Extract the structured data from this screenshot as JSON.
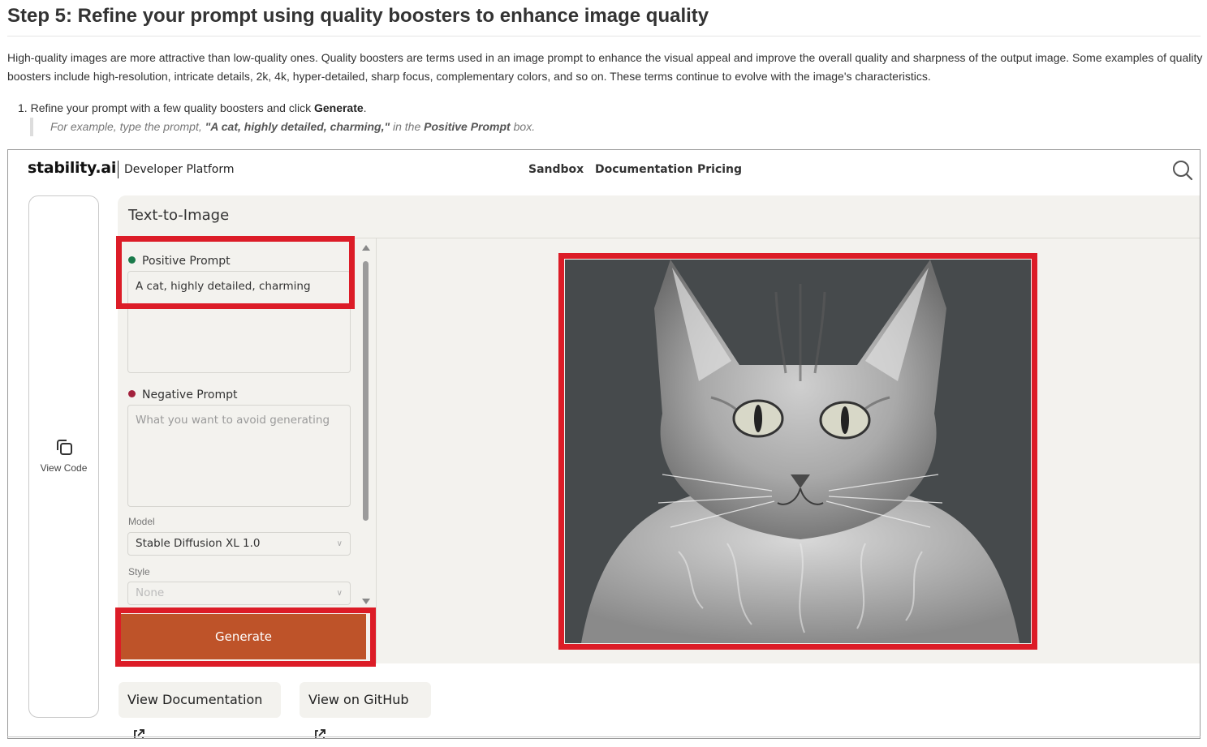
{
  "doc": {
    "title": "Step 5: Refine your prompt using quality boosters to enhance image quality",
    "paragraph": "High-quality images are more attractive than low-quality ones. Quality boosters are terms used in an image prompt to enhance the visual appeal and improve the overall quality and sharpness of the output image. Some examples of quality boosters include high-resolution, intricate details, 2k, 4k, hyper-detailed, sharp focus, complementary colors, and so on. These terms continue to evolve with the image's characteristics.",
    "step_number": "1.",
    "step_text": "Refine your prompt with a few quality boosters and click ",
    "step_bold": "Generate",
    "step_end": ".",
    "note_pre": "For example, type the prompt, ",
    "note_prompt": "\"A cat, highly detailed, charming,\"",
    "note_mid": " in the ",
    "note_field": "Positive Prompt",
    "note_end": " box."
  },
  "app": {
    "logo": "stability.ai",
    "platform": "Developer Platform",
    "nav": [
      "Sandbox",
      "Documentation",
      "Pricing"
    ],
    "search_icon": "search-icon",
    "view_code_label": "View Code",
    "page_title": "Text-to-Image",
    "positive_label": "Positive Prompt",
    "positive_value": "A cat, highly detailed, charming",
    "negative_label": "Negative Prompt",
    "negative_placeholder": "What you want to avoid generating",
    "model_label": "Model",
    "model_value": "Stable Diffusion XL 1.0",
    "style_label": "Style",
    "style_value": "None",
    "generate_label": "Generate",
    "view_docs_label": "View Documentation",
    "view_github_label": "View on GitHub"
  },
  "colors": {
    "accent_generate": "#be5329",
    "highlight_red": "#dc1c27",
    "positive_dot": "#1a7a4a",
    "negative_dot": "#a3223d",
    "panel_bg": "#f3f2ee"
  }
}
